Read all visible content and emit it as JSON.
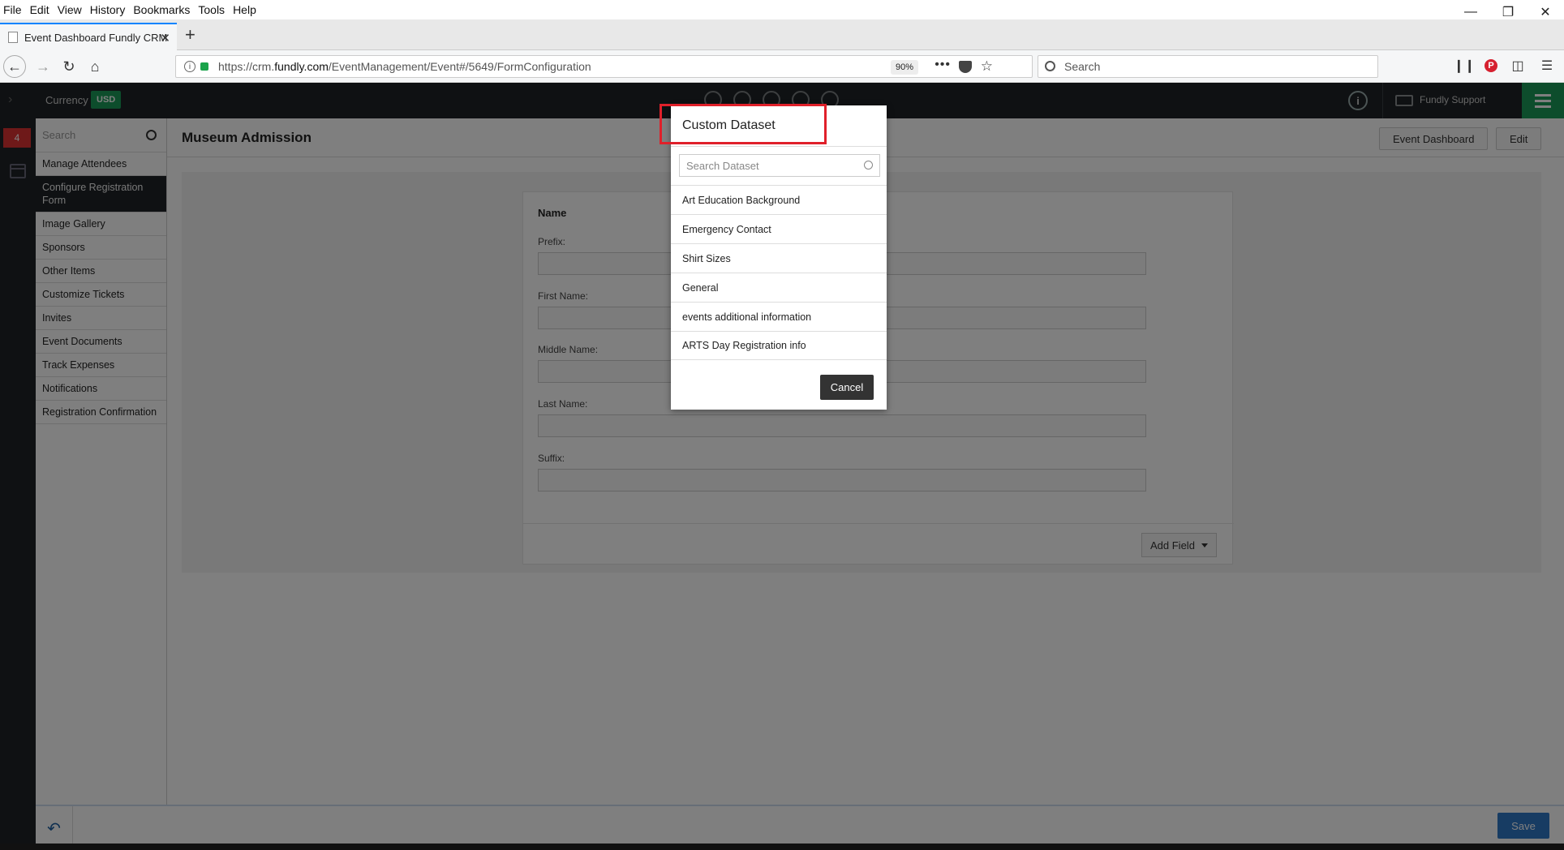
{
  "browser": {
    "menu": [
      "File",
      "Edit",
      "View",
      "History",
      "Bookmarks",
      "Tools",
      "Help"
    ],
    "tab_title": "Event Dashboard Fundly CRM",
    "url_prefix": "https://crm.",
    "url_domain": "fundly.com",
    "url_path": "/EventManagement/Event#/5649/FormConfiguration",
    "zoom": "90%",
    "search_placeholder": "Search"
  },
  "app": {
    "currency_label": "Currency",
    "currency_value": "USD",
    "user_menu": "Fundly Support",
    "notification_count": "4",
    "sidebar": {
      "search_placeholder": "Search",
      "items": [
        "Manage Attendees",
        "Configure Registration Form",
        "Image Gallery",
        "Sponsors",
        "Other Items",
        "Customize Tickets",
        "Invites",
        "Event Documents",
        "Track Expenses",
        "Notifications",
        "Registration Confirmation"
      ],
      "active_index": 1
    },
    "page_title": "Museum Admission",
    "header_buttons": {
      "dashboard": "Event Dashboard",
      "edit": "Edit"
    },
    "form": {
      "section_title": "Name",
      "fields": [
        "Prefix:",
        "First Name:",
        "Middle Name:",
        "Last Name:",
        "Suffix:"
      ],
      "add_field_label": "Add Field"
    },
    "save_label": "Save"
  },
  "modal": {
    "title": "Custom Dataset",
    "search_placeholder": "Search Dataset",
    "datasets": [
      "Art Education Background",
      "Emergency Contact",
      "Shirt Sizes",
      "General",
      "events additional information",
      "ARTS Day Registration info"
    ],
    "cancel_label": "Cancel"
  },
  "colors": {
    "accent_green": "#1b9a59",
    "highlight_red": "#e0202a",
    "save_blue": "#2f79c7"
  }
}
